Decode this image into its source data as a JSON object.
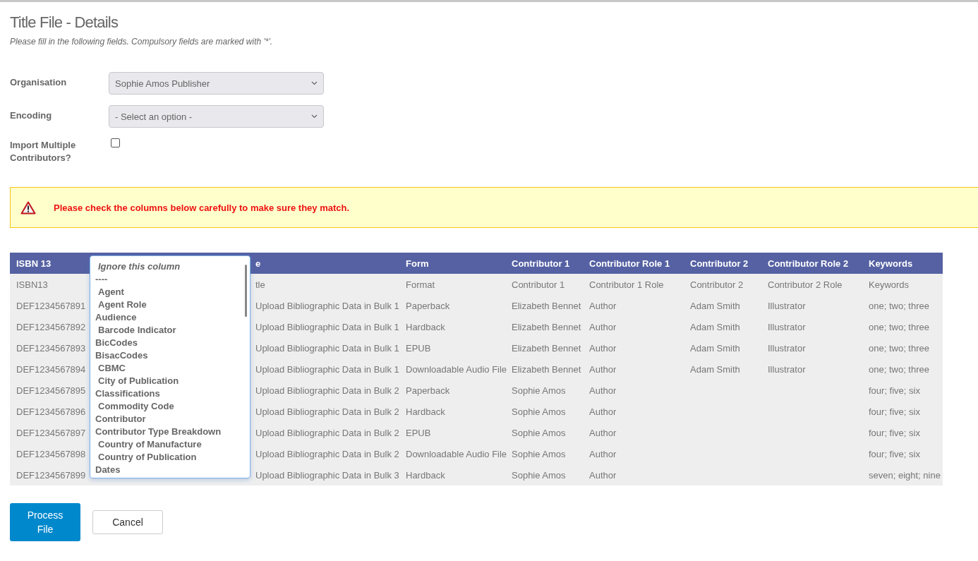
{
  "page": {
    "title": "Title File - Details",
    "instructions": "Please fill in the following fields. Compulsory fields are marked with '*'."
  },
  "form": {
    "fields": [
      {
        "kind": "select",
        "label": "Organisation",
        "value": "Sophie Amos Publisher"
      },
      {
        "kind": "select",
        "label": "Encoding",
        "value": "- Select an option -"
      },
      {
        "kind": "checkbox",
        "label": "Import Multiple Contributors?",
        "checked": false
      }
    ]
  },
  "warning": {
    "message": "Please check the columns below carefully to make sure they match."
  },
  "table": {
    "columns": [
      {
        "label": "ISBN 13"
      },
      {
        "label": "e"
      },
      {
        "label": "Form"
      },
      {
        "label": "Contributor 1"
      },
      {
        "label": "Contributor Role 1"
      },
      {
        "label": "Contributor 2"
      },
      {
        "label": "Contributor Role 2"
      },
      {
        "label": "Keywords"
      }
    ],
    "rows": [
      {
        "isbn_13": "ISBN13",
        "column_3": "tle",
        "form": "Format",
        "contributor_1": "Contributor 1",
        "contributor_role_1": "Contributor 1 Role",
        "contributor_2": "Contributor 2",
        "contributor_role_2": "Contributor 2 Role",
        "keywords": "Keywords"
      },
      {
        "isbn_13": "DEF1234567891",
        "column_3": "Upload Bibliographic Data in Bulk 1",
        "form": "Paperback",
        "contributor_1": "Elizabeth Bennet",
        "contributor_role_1": "Author",
        "contributor_2": "Adam Smith",
        "contributor_role_2": "Illustrator",
        "keywords": "one; two; three"
      },
      {
        "isbn_13": "DEF1234567892",
        "column_3": "Upload Bibliographic Data in Bulk 1",
        "form": "Hardback",
        "contributor_1": "Elizabeth Bennet",
        "contributor_role_1": "Author",
        "contributor_2": "Adam Smith",
        "contributor_role_2": "Illustrator",
        "keywords": "one; two; three"
      },
      {
        "isbn_13": "DEF1234567893",
        "column_3": "Upload Bibliographic Data in Bulk 1",
        "form": "EPUB",
        "contributor_1": "Elizabeth Bennet",
        "contributor_role_1": "Author",
        "contributor_2": "Adam Smith",
        "contributor_role_2": "Illustrator",
        "keywords": "one; two; three"
      },
      {
        "isbn_13": "DEF1234567894",
        "column_3": "Upload Bibliographic Data in Bulk 1",
        "form": "Downloadable Audio File",
        "contributor_1": "Elizabeth Bennet",
        "contributor_role_1": "Author",
        "contributor_2": "Adam Smith",
        "contributor_role_2": "Illustrator",
        "keywords": "one; two; three"
      },
      {
        "isbn_13": "DEF1234567895",
        "column_3": "Upload Bibliographic Data in Bulk 2",
        "form": "Paperback",
        "contributor_1": "Sophie Amos",
        "contributor_role_1": "Author",
        "keywords": "four; five; six"
      },
      {
        "isbn_13": "DEF1234567896",
        "column_3": "Upload Bibliographic Data in Bulk 2",
        "form": "Hardback",
        "contributor_1": "Sophie Amos",
        "contributor_role_1": "Author",
        "keywords": "four; five; six"
      },
      {
        "isbn_13": "DEF1234567897",
        "column_3": "Upload Bibliographic Data in Bulk 2",
        "form": "EPUB",
        "contributor_1": "Sophie Amos",
        "contributor_role_1": "Author",
        "keywords": "four; five; six"
      },
      {
        "isbn_13": "DEF1234567898",
        "column_3": "Upload Bibliographic Data in Bulk 2",
        "form": "Downloadable Audio File",
        "contributor_1": "Sophie Amos",
        "contributor_role_1": "Author",
        "keywords": "four; five; six"
      },
      {
        "isbn_13": "DEF1234567899",
        "column_3": "Upload Bibliographic Data in Bulk 3",
        "form": "Hardback",
        "contributor_1": "Sophie Amos",
        "contributor_role_1": "Author",
        "keywords": "seven; eight; nine"
      }
    ]
  },
  "column_dropdown": {
    "options": [
      {
        "kind": "placeholder",
        "label": "Ignore this column"
      },
      {
        "kind": "group",
        "label": "----"
      },
      {
        "kind": "option",
        "label": "Agent"
      },
      {
        "kind": "option",
        "label": "Agent Role"
      },
      {
        "kind": "group",
        "label": "Audience"
      },
      {
        "kind": "option",
        "label": "Barcode Indicator"
      },
      {
        "kind": "group",
        "label": "BicCodes"
      },
      {
        "kind": "group",
        "label": "BisacCodes"
      },
      {
        "kind": "option",
        "label": "CBMC"
      },
      {
        "kind": "option",
        "label": "City of Publication"
      },
      {
        "kind": "group",
        "label": "Classifications"
      },
      {
        "kind": "option",
        "label": "Commodity Code"
      },
      {
        "kind": "group",
        "label": "Contributor"
      },
      {
        "kind": "group",
        "label": "Contributor Type Breakdown"
      },
      {
        "kind": "option",
        "label": "Country of Manufacture"
      },
      {
        "kind": "option",
        "label": "Country of Publication"
      },
      {
        "kind": "group",
        "label": "Dates"
      }
    ]
  },
  "buttons": [
    {
      "kind": "primary",
      "label": "Process File"
    },
    {
      "kind": "secondary",
      "label": "Cancel"
    }
  ]
}
